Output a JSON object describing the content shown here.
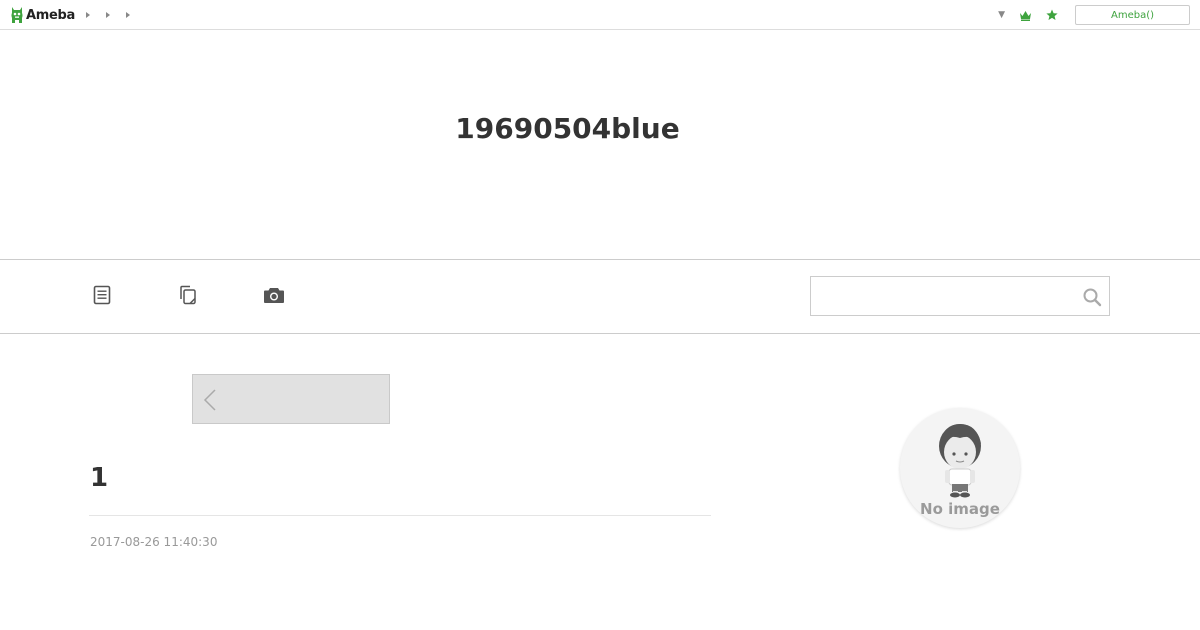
{
  "topbar": {
    "logo_text": "Ameba",
    "ameba_button_label": "Ameba()",
    "dropdown_caret": "▼",
    "brand_color": "#3ea33e"
  },
  "header": {
    "blog_title": "19690504blue"
  },
  "navbar": {
    "icons": [
      "entry-list-icon",
      "theme-list-icon",
      "camera-icon"
    ],
    "search": {
      "value": "",
      "placeholder": ""
    }
  },
  "entry": {
    "title": "1",
    "date": "2017-08-26 11:40:30"
  },
  "profile": {
    "avatar_label": "No image"
  }
}
